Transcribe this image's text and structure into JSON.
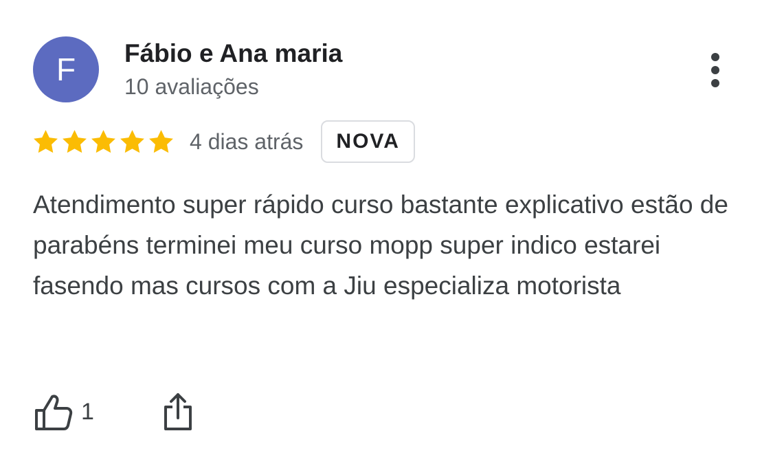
{
  "review": {
    "avatar_letter": "F",
    "avatar_color": "#5c6bc0",
    "author_name": "Fábio e Ana maria",
    "author_reviews": "10 avaliações",
    "rating": 5,
    "rating_max": 5,
    "star_color": "#fbbc04",
    "date": "4 dias atrás",
    "badge": "NOVA",
    "text": "Atendimento super rápido curso bastante explicativo estão de parabéns terminei meu curso mopp super indico estarei fasendo mas cursos com a Jiu especializa motorista",
    "like_count": "1"
  },
  "icons": {
    "more": "more-vert-icon",
    "star": "star-icon",
    "like": "thumb-up-icon",
    "share": "share-icon"
  }
}
